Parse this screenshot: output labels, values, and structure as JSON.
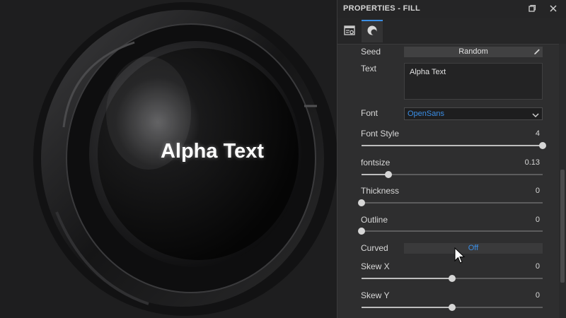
{
  "panel": {
    "title": "PROPERTIES - FILL"
  },
  "tabs": [
    {
      "icon": "layer-settings-icon",
      "active": false
    },
    {
      "icon": "material-sphere-icon",
      "active": true
    }
  ],
  "preview": {
    "text": "Alpha Text"
  },
  "properties": {
    "seed": {
      "label": "Seed",
      "button": "Random"
    },
    "text": {
      "label": "Text",
      "value": "Alpha Text"
    },
    "font": {
      "label": "Font",
      "value": "OpenSans"
    },
    "font_style": {
      "label": "Font Style",
      "value": "4",
      "level": 1.0
    },
    "fontsize": {
      "label": "fontsize",
      "value": "0.13",
      "level": 0.15
    },
    "thickness": {
      "label": "Thickness",
      "value": "0",
      "level": 0.0
    },
    "outline": {
      "label": "Outline",
      "value": "0",
      "level": 0.0
    },
    "curved": {
      "label": "Curved",
      "value": "Off"
    },
    "skew_x": {
      "label": "Skew X",
      "value": "0",
      "level": 0.5
    },
    "skew_y": {
      "label": "Skew Y",
      "value": "0",
      "level": 0.5
    }
  },
  "colors": {
    "accent": "#3a8ee6"
  }
}
